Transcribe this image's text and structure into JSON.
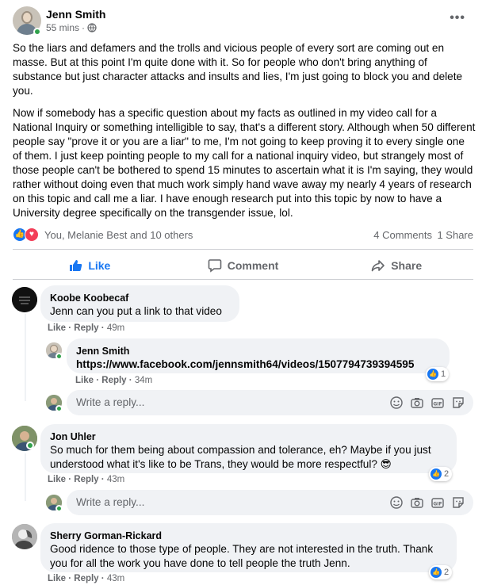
{
  "post": {
    "author": "Jenn Smith",
    "time": "55 mins",
    "separator": "·",
    "paragraphs": [
      "So the liars and defamers and the trolls and vicious people of every sort are coming out en masse. But at this point I'm quite done with it. So for people who don't bring anything of substance but just character attacks and insults and lies, I'm just going to block you and delete you.",
      "Now if somebody has a specific question about my facts as outlined in my video call for a National Inquiry or something intelligible to say, that's a different story. Although when 50 different people say \"prove it or you are a liar\" to me, I'm not going to keep proving it to every single one of them. I just keep pointing people to my call for a national inquiry video, but strangely most of those people can't be bothered to spend 15 minutes to ascertain what it is I'm saying, they would rather without doing even that much work simply hand wave away my nearly 4 years of research on this topic and call me a liar. I have enough research put into this topic by now to have a University degree specifically on the transgender issue, lol."
    ],
    "reactions_summary": "You, Melanie Best and 10 others",
    "comments_count": "4 Comments",
    "shares_count": "1 Share",
    "more_icon": "more-horizontal-icon"
  },
  "actions": {
    "like": "Like",
    "comment": "Comment",
    "share": "Share"
  },
  "comments": [
    {
      "name": "Koobe Koobecaf",
      "text": "Jenn can you put a link to that video",
      "like": "Like",
      "reply": "Reply",
      "time": "49m"
    },
    {
      "name": "Jenn Smith",
      "text": "https://www.facebook.com/jennsmith64/videos/1507794739394595",
      "like": "Like",
      "reply": "Reply",
      "time": "34m",
      "reaction_count": "1"
    },
    {
      "name": "Jon Uhler",
      "text": "So much for them being about compassion and tolerance, eh? Maybe if you just understood what it's like to be Trans, they would be more respectful? 😎",
      "like": "Like",
      "reply": "Reply",
      "time": "43m",
      "reaction_count": "2"
    },
    {
      "name": "Sherry Gorman-Rickard",
      "text": "Good ridence to those type of people. They are not interested in the truth. Thank you for all the work you have done to tell people the truth Jenn.",
      "like": "Like",
      "reply": "Reply",
      "time": "43m",
      "reaction_count": "2"
    }
  ],
  "reply_placeholder": "Write a reply...",
  "link_separator": "·",
  "colors": {
    "facebook_blue": "#1877f2",
    "love_red": "#f33e58",
    "bubble_gray": "#f0f2f5",
    "secondary_text": "#65676b",
    "online_green": "#31a24c"
  }
}
